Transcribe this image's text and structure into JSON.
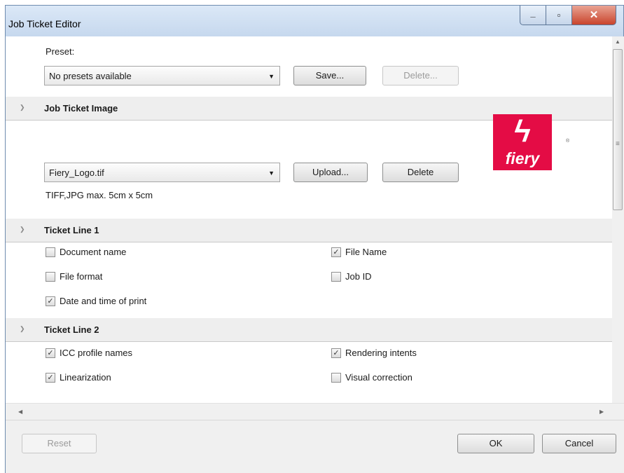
{
  "window": {
    "title": "Job Ticket Editor",
    "min_icon": "minimize-icon",
    "max_icon": "maximize-icon",
    "close_icon": "close-icon"
  },
  "preset": {
    "label": "Preset:",
    "selected": "No presets available",
    "save_label": "Save...",
    "delete_label": "Delete..."
  },
  "image_section": {
    "title": "Job Ticket Image",
    "selected_file": "Fiery_Logo.tif",
    "upload_label": "Upload...",
    "delete_label": "Delete",
    "hint": "TIFF,JPG  max. 5cm x 5cm",
    "logo_text": "fiery",
    "logo_mark": "®"
  },
  "ticket_line_1": {
    "title": "Ticket Line 1",
    "items": [
      {
        "label": "Document name",
        "checked": false
      },
      {
        "label": "File Name",
        "checked": true
      },
      {
        "label": "File format",
        "checked": false
      },
      {
        "label": "Job ID",
        "checked": false
      },
      {
        "label": "Date and time of print",
        "checked": true
      }
    ]
  },
  "ticket_line_2": {
    "title": "Ticket Line 2",
    "items": [
      {
        "label": "ICC profile names",
        "checked": true
      },
      {
        "label": "Rendering intents",
        "checked": true
      },
      {
        "label": "Linearization",
        "checked": true
      },
      {
        "label": "Visual correction",
        "checked": false
      }
    ]
  },
  "footer": {
    "reset_label": "Reset",
    "ok_label": "OK",
    "cancel_label": "Cancel"
  },
  "colors": {
    "logo_bg": "#e40c45",
    "title_bar": "#c6d8ee",
    "close_button": "#c9442c"
  }
}
